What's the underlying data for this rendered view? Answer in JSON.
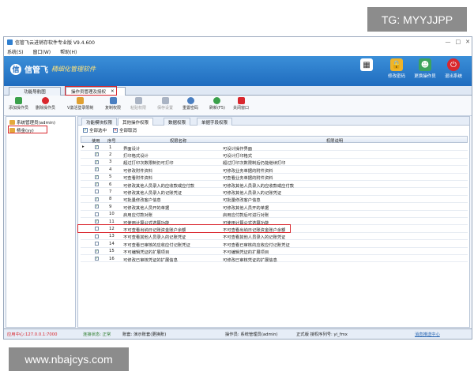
{
  "watermarks": {
    "top_right": "TG: MYYJJPP",
    "bottom_left": "www.nbajcys.com"
  },
  "window": {
    "title": "信管飞云进销存软件专业版 V9.4.600",
    "controls": [
      "—",
      "□",
      "✕"
    ]
  },
  "menu": [
    "系统(S)",
    "窗口(W)",
    "帮助(H)"
  ],
  "banner": {
    "logo_mark": "信",
    "logo_text": "信管飞",
    "tagline": "精细化管理软件",
    "buttons": [
      {
        "label": "修改密码",
        "icon": "lock-icon",
        "color": "#f0b429"
      },
      {
        "label": "更换操作员",
        "icon": "user-icon",
        "color": "#3da35d"
      },
      {
        "label": "退出系统",
        "icon": "exit-icon",
        "color": "#d9272e"
      }
    ],
    "calendar_icon": "calendar-icon"
  },
  "tabs": [
    {
      "label": "功能导航图"
    },
    {
      "label": "操作员管理及授权",
      "close": "✕",
      "active": true
    }
  ],
  "toolbar": [
    {
      "label": "添加操作员",
      "icon": "add-icon",
      "color": "#3aa04a"
    },
    {
      "label": "删除操作员",
      "icon": "delete-icon",
      "color": "#d9272e"
    },
    {
      "label": "V激活登录限制",
      "icon": "key-icon",
      "color": "#e0a030"
    },
    {
      "label": "复制权限",
      "icon": "copy-icon",
      "color": "#4a7fc1"
    },
    {
      "label": "粘贴权限",
      "icon": "paste-icon",
      "color": "#aab4c4"
    },
    {
      "label": "保存设置",
      "icon": "save-icon",
      "color": "#aab4c4"
    },
    {
      "label": "重置密码",
      "icon": "reset-icon",
      "color": "#4a7fc1"
    },
    {
      "label": "刷新(F5)",
      "icon": "refresh-icon",
      "color": "#3aa04a"
    },
    {
      "label": "关闭窗口",
      "icon": "close-window-icon",
      "color": "#d9272e"
    }
  ],
  "sidebar": {
    "items": [
      {
        "label": "系统管理员(admin)"
      },
      {
        "label": "杨金(yy)"
      }
    ]
  },
  "subtabs": [
    "功能模块权限",
    "其他操作权限",
    "数据权限",
    "单据字段权限"
  ],
  "select": {
    "all": "全部选中",
    "none": "全部取消"
  },
  "grid": {
    "headers": [
      "使用",
      "序号",
      "权限名称",
      "权限说明"
    ],
    "rows": [
      {
        "checked": true,
        "no": "1",
        "name": "界面设计",
        "desc": "可设计操作界面"
      },
      {
        "checked": true,
        "no": "2",
        "name": "打印格式设计",
        "desc": "可设计打印格式"
      },
      {
        "checked": true,
        "no": "3",
        "name": "超过打印次数限制仍可打印",
        "desc": "超过打印次数限制后仍能继续打印"
      },
      {
        "checked": true,
        "no": "4",
        "name": "可修改附件资料",
        "desc": "可修改业务单据的附件资料"
      },
      {
        "checked": true,
        "no": "5",
        "name": "可查看附件资料",
        "desc": "可查看业务单据的附件资料"
      },
      {
        "checked": true,
        "no": "6",
        "name": "可修改其他人员录入的应收款或应付款",
        "desc": "可修改其他人员录入的应收款或应付款"
      },
      {
        "checked": false,
        "no": "7",
        "name": "可修改其他人员录入的记账凭证",
        "desc": "可修改其他人员录入的记账凭证"
      },
      {
        "checked": true,
        "no": "8",
        "name": "可批量修改客户信息",
        "desc": "可批量修改客户信息"
      },
      {
        "checked": true,
        "no": "9",
        "name": "可修改其他人员开的单据",
        "desc": "可修改其他人员开的单据"
      },
      {
        "checked": false,
        "no": "10",
        "name": "启用应付款对账",
        "desc": "启用应付款后可进行对账"
      },
      {
        "checked": true,
        "no": "11",
        "name": "可使用计算公式选算功能",
        "desc": "可使用计算公式选算功能"
      },
      {
        "checked": false,
        "no": "12",
        "name": "不可查看出纳日记账资金账户余额",
        "desc": "不可查看出纳日记账资金账户余额",
        "highlight": true
      },
      {
        "checked": false,
        "no": "13",
        "name": "不可查看其他人员录入的记账凭证",
        "desc": "不可查看其他人员录入的记账凭证"
      },
      {
        "checked": false,
        "no": "14",
        "name": "不可查看已审核的应收应付记账凭证",
        "desc": "不可查看已审核的应收应付记账凭证"
      },
      {
        "checked": true,
        "no": "15",
        "name": "不可编辑凭证的扩展项目",
        "desc": "不可编辑凭证的扩展项目"
      },
      {
        "checked": true,
        "no": "16",
        "name": "可修改已审核凭证的扩展信息",
        "desc": "可修改已审核凭证的扩展信息"
      }
    ]
  },
  "status": {
    "app_center": "应用中心:127.0.0.1:7000",
    "connection": "连接状态: 正常",
    "location": "账套: 演示账套(更换账)",
    "operator": "操作员: 系统管理员(admin)",
    "license": "正式版 授权序列号: yi_fmx",
    "message": "消息推送中心"
  }
}
